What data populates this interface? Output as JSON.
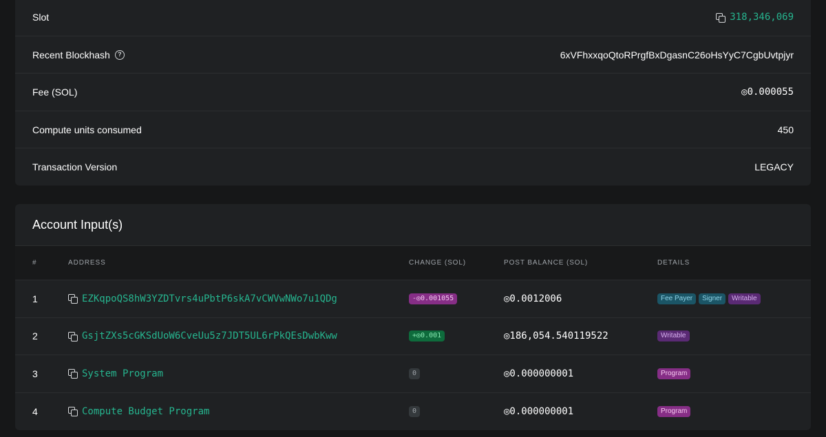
{
  "details": {
    "slot": {
      "label": "Slot",
      "value": "318,346,069"
    },
    "blockhash": {
      "label": "Recent Blockhash",
      "value": "6xVFhxxqoQtoRPrgfBxDgasnC26oHsYyC7CgbUvtpjyr"
    },
    "fee": {
      "label": "Fee (SOL)",
      "value": "◎0.000055"
    },
    "compute": {
      "label": "Compute units consumed",
      "value": "450"
    },
    "version": {
      "label": "Transaction Version",
      "value": "LEGACY"
    }
  },
  "accounts": {
    "title": "Account Input(s)",
    "columns": [
      "#",
      "ADDRESS",
      "CHANGE (SOL)",
      "POST BALANCE (SOL)",
      "DETAILS"
    ],
    "rows": [
      {
        "num": "1",
        "address": "EZKqpoQS8hW3YZDTvrs4uPbtP6skA7vCWVwNWo7u1QDg",
        "change": "-◎0.001055",
        "balance": "◎0.0012006",
        "tags": [
          "Fee Payer",
          "Signer",
          "Writable"
        ]
      },
      {
        "num": "2",
        "address": "GsjtZXs5cGKSdUoW6CveUu5z7JDT5UL6rPkQEsDwbKww",
        "change": "+◎0.001",
        "balance": "◎186,054.540119522",
        "tags": [
          "Writable"
        ]
      },
      {
        "num": "3",
        "address": "System Program",
        "change": "0",
        "balance": "◎0.000000001",
        "tags": [
          "Program"
        ]
      },
      {
        "num": "4",
        "address": "Compute Budget Program",
        "change": "0",
        "balance": "◎0.000000001",
        "tags": [
          "Program"
        ]
      }
    ]
  },
  "colors": {
    "accent": "#26b58f",
    "background": "#161718",
    "card": "#1f2123"
  }
}
